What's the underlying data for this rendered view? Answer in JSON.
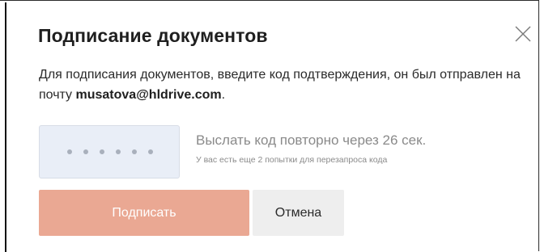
{
  "dialog": {
    "title": "Подписание документов",
    "description_prefix": "Для подписания документов, введите код подтверждения, он был отправлен на почту ",
    "email": "musatova@hldrive.com",
    "description_suffix": ".",
    "code_field": {
      "placeholder": "••••••",
      "value": ""
    },
    "resend_text": "Выслать код повторно через 26 сек.",
    "attempts_text": "У вас есть еще 2 попытки для перезапроса кода",
    "sign_label": "Подписать",
    "cancel_label": "Отмена",
    "close_icon": "close-icon"
  },
  "colors": {
    "sign_button": "#eaa893",
    "cancel_button": "#eeeeee",
    "code_field_bg": "#e9eef7",
    "muted_text": "#8a8a8a"
  }
}
